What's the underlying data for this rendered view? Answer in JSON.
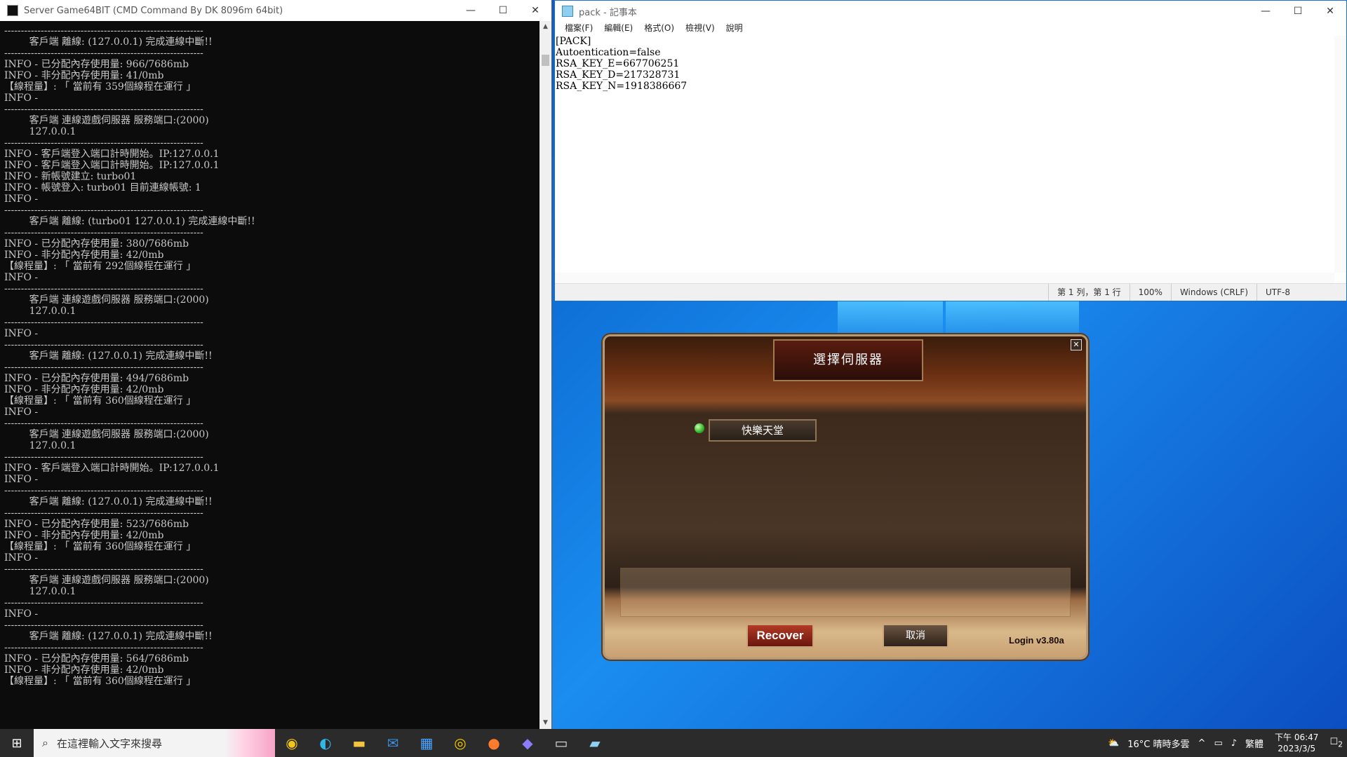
{
  "cmd": {
    "title": "Server Game64BIT  (CMD Command By DK 8096m 64bit)",
    "lines": [
      "------------------------------------------------------------",
      "        客戶端 離線: (127.0.0.1) 完成連線中斷!!",
      "------------------------------------------------------------",
      "INFO - 已分配內存使用量: 966/7686mb",
      "INFO - 非分配內存使用量: 41/0mb",
      "【線程量】: 「 當前有 359個線程在運行 」",
      "INFO - ",
      "------------------------------------------------------------",
      "        客戶端 連線遊戲伺服器 服務端口:(2000)",
      "        127.0.0.1",
      "------------------------------------------------------------",
      "INFO - 客戶端登入端口計時開始。IP:127.0.0.1",
      "INFO - 客戶端登入端口計時開始。IP:127.0.0.1",
      "INFO - 新帳號建立: turbo01",
      "INFO - 帳號登入: turbo01 目前連線帳號: 1",
      "INFO - ",
      "------------------------------------------------------------",
      "        客戶端 離線: (turbo01 127.0.0.1) 完成連線中斷!!",
      "------------------------------------------------------------",
      "INFO - 已分配內存使用量: 380/7686mb",
      "INFO - 非分配內存使用量: 42/0mb",
      "【線程量】: 「 當前有 292個線程在運行 」",
      "INFO - ",
      "------------------------------------------------------------",
      "        客戶端 連線遊戲伺服器 服務端口:(2000)",
      "        127.0.0.1",
      "------------------------------------------------------------",
      "INFO - ",
      "------------------------------------------------------------",
      "        客戶端 離線: (127.0.0.1) 完成連線中斷!!",
      "------------------------------------------------------------",
      "INFO - 已分配內存使用量: 494/7686mb",
      "INFO - 非分配內存使用量: 42/0mb",
      "【線程量】: 「 當前有 360個線程在運行 」",
      "INFO - ",
      "------------------------------------------------------------",
      "        客戶端 連線遊戲伺服器 服務端口:(2000)",
      "        127.0.0.1",
      "------------------------------------------------------------",
      "INFO - 客戶端登入端口計時開始。IP:127.0.0.1",
      "INFO - ",
      "------------------------------------------------------------",
      "        客戶端 離線: (127.0.0.1) 完成連線中斷!!",
      "------------------------------------------------------------",
      "INFO - 已分配內存使用量: 523/7686mb",
      "INFO - 非分配內存使用量: 42/0mb",
      "【線程量】: 「 當前有 360個線程在運行 」",
      "INFO - ",
      "------------------------------------------------------------",
      "        客戶端 連線遊戲伺服器 服務端口:(2000)",
      "        127.0.0.1",
      "------------------------------------------------------------",
      "INFO - ",
      "------------------------------------------------------------",
      "        客戶端 離線: (127.0.0.1) 完成連線中斷!!",
      "------------------------------------------------------------",
      "INFO - 已分配內存使用量: 564/7686mb",
      "INFO - 非分配內存使用量: 42/0mb",
      "【線程量】: 「 當前有 360個線程在運行 」"
    ]
  },
  "notepad": {
    "title": "pack - 記事本",
    "menu": [
      "檔案(F)",
      "編輯(E)",
      "格式(O)",
      "檢視(V)",
      "說明"
    ],
    "content": "[PACK]\nAutoentication=false\nRSA_KEY_E=667706251\nRSA_KEY_D=217328731\nRSA_KEY_N=1918386667",
    "status": {
      "position": "第 1 列，第 1 行",
      "zoom": "100%",
      "eol": "Windows (CRLF)",
      "encoding": "UTF-8"
    }
  },
  "dialog": {
    "title": "選擇伺服器",
    "server_name": "快樂天堂",
    "recover_label": "Recover",
    "cancel_label": "取消",
    "version": "Login v3.80a"
  },
  "taskbar": {
    "search_placeholder": "在這裡輸入文字來搜尋",
    "apps": [
      "chrome-icon",
      "edge-icon",
      "file-explorer-icon",
      "mail-icon",
      "store-icon",
      "app-icon",
      "firefox-icon",
      "app2-icon",
      "terminal-icon",
      "notepad-icon"
    ],
    "weather": "16°C  晴時多雲",
    "ime": "繁體",
    "time": "下午 06:47",
    "date": "2023/3/5",
    "notifications": "2"
  }
}
